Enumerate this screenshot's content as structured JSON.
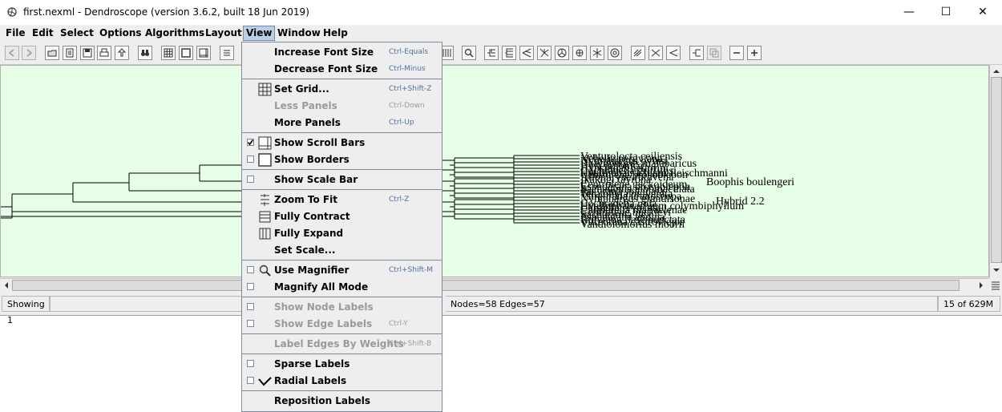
{
  "window": {
    "title": "first.nexml - Dendroscope (version 3.6.2, built 18 Jun 2019)",
    "minimize": "—",
    "maximize": "☐",
    "close": "✕"
  },
  "menubar": [
    "File",
    "Edit",
    "Select",
    "Options",
    "Algorithms",
    "Layout",
    "View",
    "Window",
    "Help"
  ],
  "view_menu": {
    "items": [
      {
        "label": "Increase Font Size",
        "accel": "Ctrl-Equals",
        "enabled": true
      },
      {
        "label": "Decrease Font Size",
        "accel": "Ctrl-Minus",
        "enabled": true
      },
      {
        "label": "Set Grid...",
        "accel": "Ctrl+Shift-Z",
        "enabled": true,
        "icon": "grid-icon"
      },
      {
        "label": "Less Panels",
        "accel": "Ctrl-Down",
        "enabled": false
      },
      {
        "label": "More Panels",
        "accel": "Ctrl-Up",
        "enabled": true
      },
      {
        "label": "Show Scroll Bars",
        "accel": "",
        "enabled": true,
        "checked": true,
        "icon": "scrollbars-icon"
      },
      {
        "label": "Show Borders",
        "accel": "",
        "enabled": true,
        "checked": false,
        "icon": "borders-icon"
      },
      {
        "label": "Show Scale Bar",
        "accel": "",
        "enabled": true,
        "checked": false
      },
      {
        "label": "Zoom To Fit",
        "accel": "Ctrl-Z",
        "enabled": true,
        "icon": "zoom-fit-icon"
      },
      {
        "label": "Fully Contract",
        "accel": "",
        "enabled": true,
        "icon": "contract-icon"
      },
      {
        "label": "Fully Expand",
        "accel": "",
        "enabled": true,
        "icon": "expand-icon"
      },
      {
        "label": "Set Scale...",
        "accel": "",
        "enabled": true
      },
      {
        "label": "Use Magnifier",
        "accel": "Ctrl+Shift-M",
        "enabled": true,
        "checked": false,
        "icon": "magnifier-icon"
      },
      {
        "label": "Magnify All Mode",
        "accel": "",
        "enabled": true,
        "checked": false
      },
      {
        "label": "Show Node Labels",
        "accel": "",
        "enabled": false,
        "checked": false
      },
      {
        "label": "Show Edge Labels",
        "accel": "Ctrl-Y",
        "enabled": false,
        "checked": false
      },
      {
        "label": "Label Edges By Weights",
        "accel": "Ctrl+Shift-B",
        "enabled": false
      },
      {
        "label": "Sparse Labels",
        "accel": "",
        "enabled": true,
        "checked": false
      },
      {
        "label": "Radial Labels",
        "accel": "",
        "enabled": true,
        "checked": false,
        "icon": "radial-icon"
      },
      {
        "label": "Reposition Labels",
        "accel": "",
        "enabled": true
      }
    ]
  },
  "tree": {
    "labels": [
      "Venturolocta ceiliensis",
      "Nebelia peruviana",
      "Nymphargus oyinsi",
      "Rhacophorus malabaricus",
      "Hyla japonica",
      "Hypsiboas heilprini",
      "Cochranella griffithsi",
      "Hyalinobatrachium fleischmanni",
      "Centrolene prosoblepon",
      "Allophryne ruthveni",
      "Ikakogi tayrona",
      "Boophis boulengeri",
      "Centrolene geckoideum",
      "Espadarana prosoblepon",
      "Sachatamia albomaculata",
      "Rulyrana spiculata",
      "Teratohyla pulverata",
      "Vitreorana uranoscopa",
      "Nymphargus grandisonae",
      "Hybrid 2.2",
      "Cochranella nola",
      "Hyalinobatrachium colymbiphyllum",
      "Celsiella revocata",
      "Chimerella mariaelenae",
      "Centrolene buckleyi",
      "Sachatamia ilex",
      "Espadarana andina",
      "Rulyrana flavopunctata",
      "Vitreorana castroviejoi",
      "Vandiolomorius moorii"
    ]
  },
  "status": {
    "left": "Showing 1",
    "middle": "Nodes=58 Edges=57",
    "right": "15 of 629M"
  }
}
